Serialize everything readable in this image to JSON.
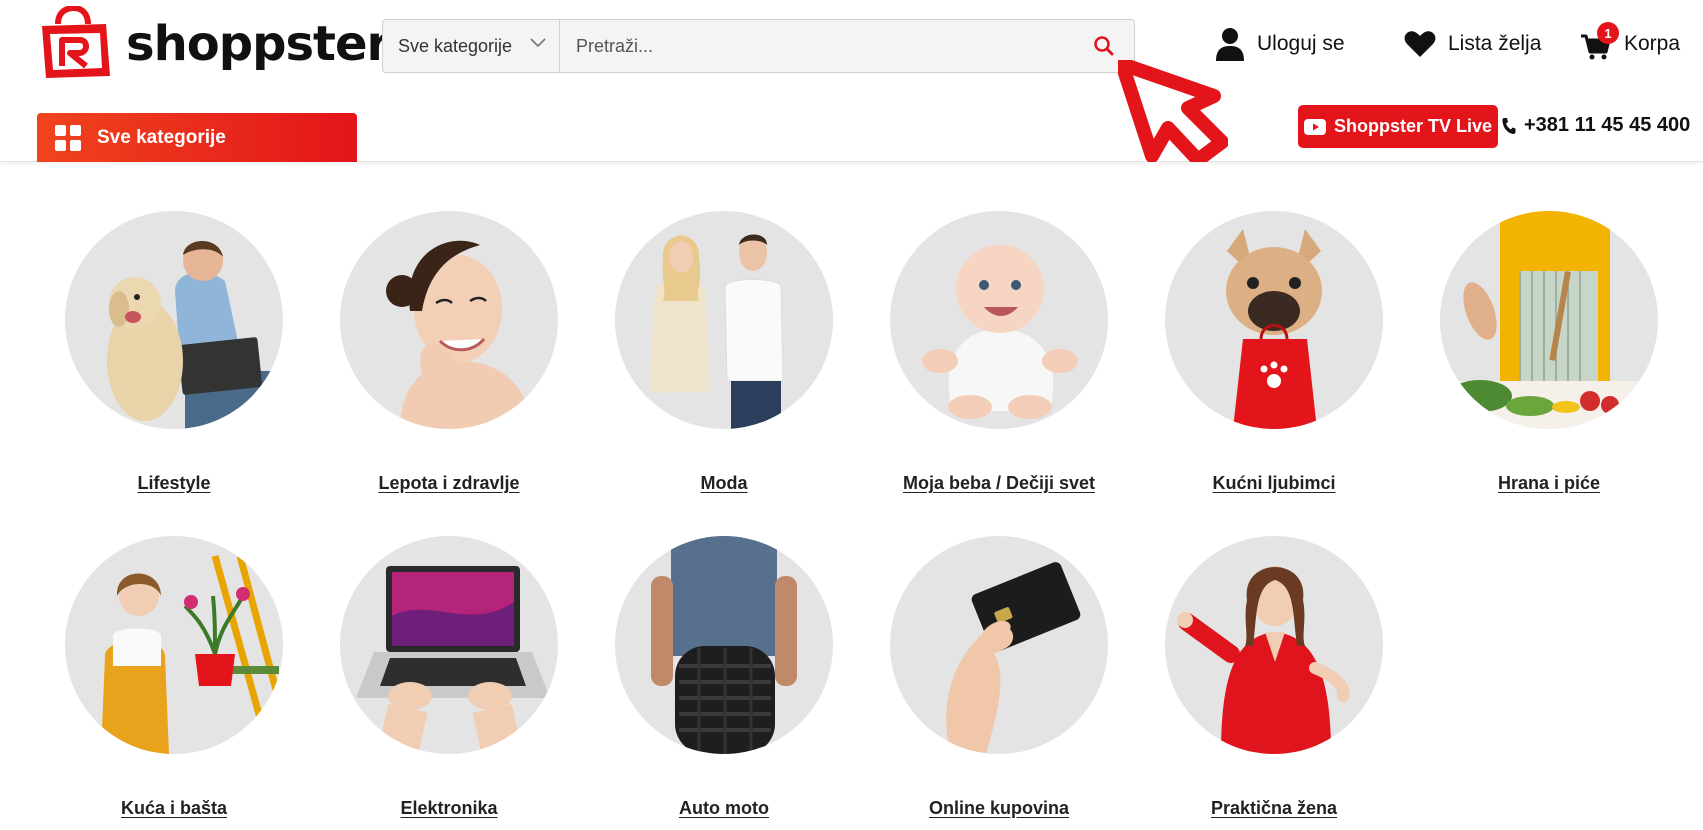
{
  "header": {
    "logo_text": "shoppster",
    "search": {
      "category_label": "Sve kategorije",
      "placeholder": "Pretraži..."
    },
    "login_label": "Uloguj se",
    "wishlist_label": "Lista želja",
    "cart_label": "Korpa",
    "cart_count": "1",
    "all_categories_label": "Sve kategorije",
    "tv_label": "Shoppster TV Live",
    "phone": "+381 11 45 45 400"
  },
  "colors": {
    "brand_red": "#e3141a",
    "brand_orange": "#f0441e"
  },
  "categories": [
    {
      "label": "Lifestyle",
      "icon": "man-with-dog-image"
    },
    {
      "label": "Lepota i zdravlje",
      "icon": "smiling-woman-image"
    },
    {
      "label": "Moda",
      "icon": "fashion-couple-image"
    },
    {
      "label": "Moja beba / Dečiji svet",
      "icon": "baby-image"
    },
    {
      "label": "Kućni ljubimci",
      "icon": "dog-with-bag-image"
    },
    {
      "label": "Hrana i piće",
      "icon": "cooking-salad-image"
    },
    {
      "label": "Kuća i bašta",
      "icon": "woman-with-plant-image"
    },
    {
      "label": "Elektronika",
      "icon": "laptop-image"
    },
    {
      "label": "Auto moto",
      "icon": "tire-image"
    },
    {
      "label": "Online kupovina",
      "icon": "credit-card-image"
    },
    {
      "label": "Praktična žena",
      "icon": "woman-in-red-image"
    }
  ]
}
